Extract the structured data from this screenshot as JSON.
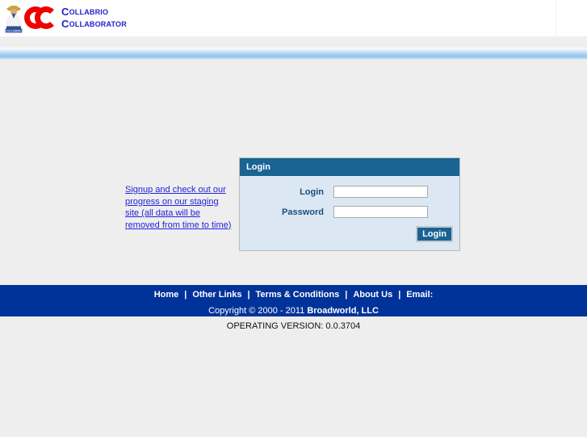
{
  "header": {
    "logo_icon": "worker-person-icon",
    "cc_mark_icon": "double-c-logo-icon",
    "brand_line_1_cap": "C",
    "brand_line_1": "OLLABRIO",
    "brand_line_2_cap": "C",
    "brand_line_2": "OLLABORATOR",
    "brand_color": "#2222cc",
    "cc_mark_color": "#ee0000"
  },
  "main": {
    "signup_link_text": "Signup and check out our progress on our staging site (all data will be removed from time to time)",
    "login_panel": {
      "title": "Login",
      "header_color": "#1a6393",
      "body_color": "#dbe8f3",
      "login_label": "Login",
      "login_value": "",
      "login_placeholder": "",
      "password_label": "Password",
      "password_value": "",
      "password_placeholder": "",
      "submit_label": "Login"
    }
  },
  "footer": {
    "bar_color": "#003399",
    "nav": [
      {
        "label": "Home"
      },
      {
        "label": "Other Links"
      },
      {
        "label": "Terms & Conditions"
      },
      {
        "label": "About Us"
      },
      {
        "label": "Email:"
      }
    ],
    "separator": "|",
    "copyright_prefix": "Copyright © 2000 - 2011 ",
    "copyright_company": "Broadworld, LLC",
    "version_text": "OPERATING VERSION: 0.0.3704"
  }
}
